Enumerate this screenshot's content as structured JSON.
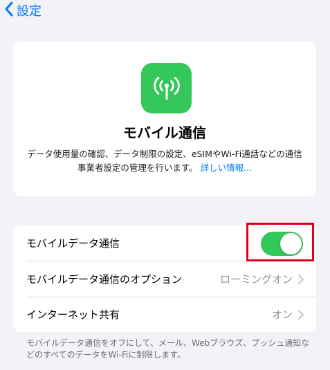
{
  "nav": {
    "back_label": "設定"
  },
  "hero": {
    "title": "モバイル通信",
    "description": "データ使用量の確認、データ制限の設定、eSIMやWi-Fi通話などの通信事業者設定の管理を行います。",
    "link_text": "詳しい情報..."
  },
  "settings": {
    "rows": [
      {
        "label": "モバイルデータ通信",
        "toggle_on": true
      },
      {
        "label": "モバイルデータ通信のオプション",
        "value": "ローミングオン"
      },
      {
        "label": "インターネット共有",
        "value": "オン"
      }
    ]
  },
  "footer": {
    "text": "モバイルデータ通信をオフにして、メール、Webブラウズ、プッシュ通知などのすべてのデータをWi-Fiに制限します。"
  },
  "colors": {
    "accent": "#007aff",
    "toggle_on": "#34c759",
    "highlight": "#e60012"
  }
}
